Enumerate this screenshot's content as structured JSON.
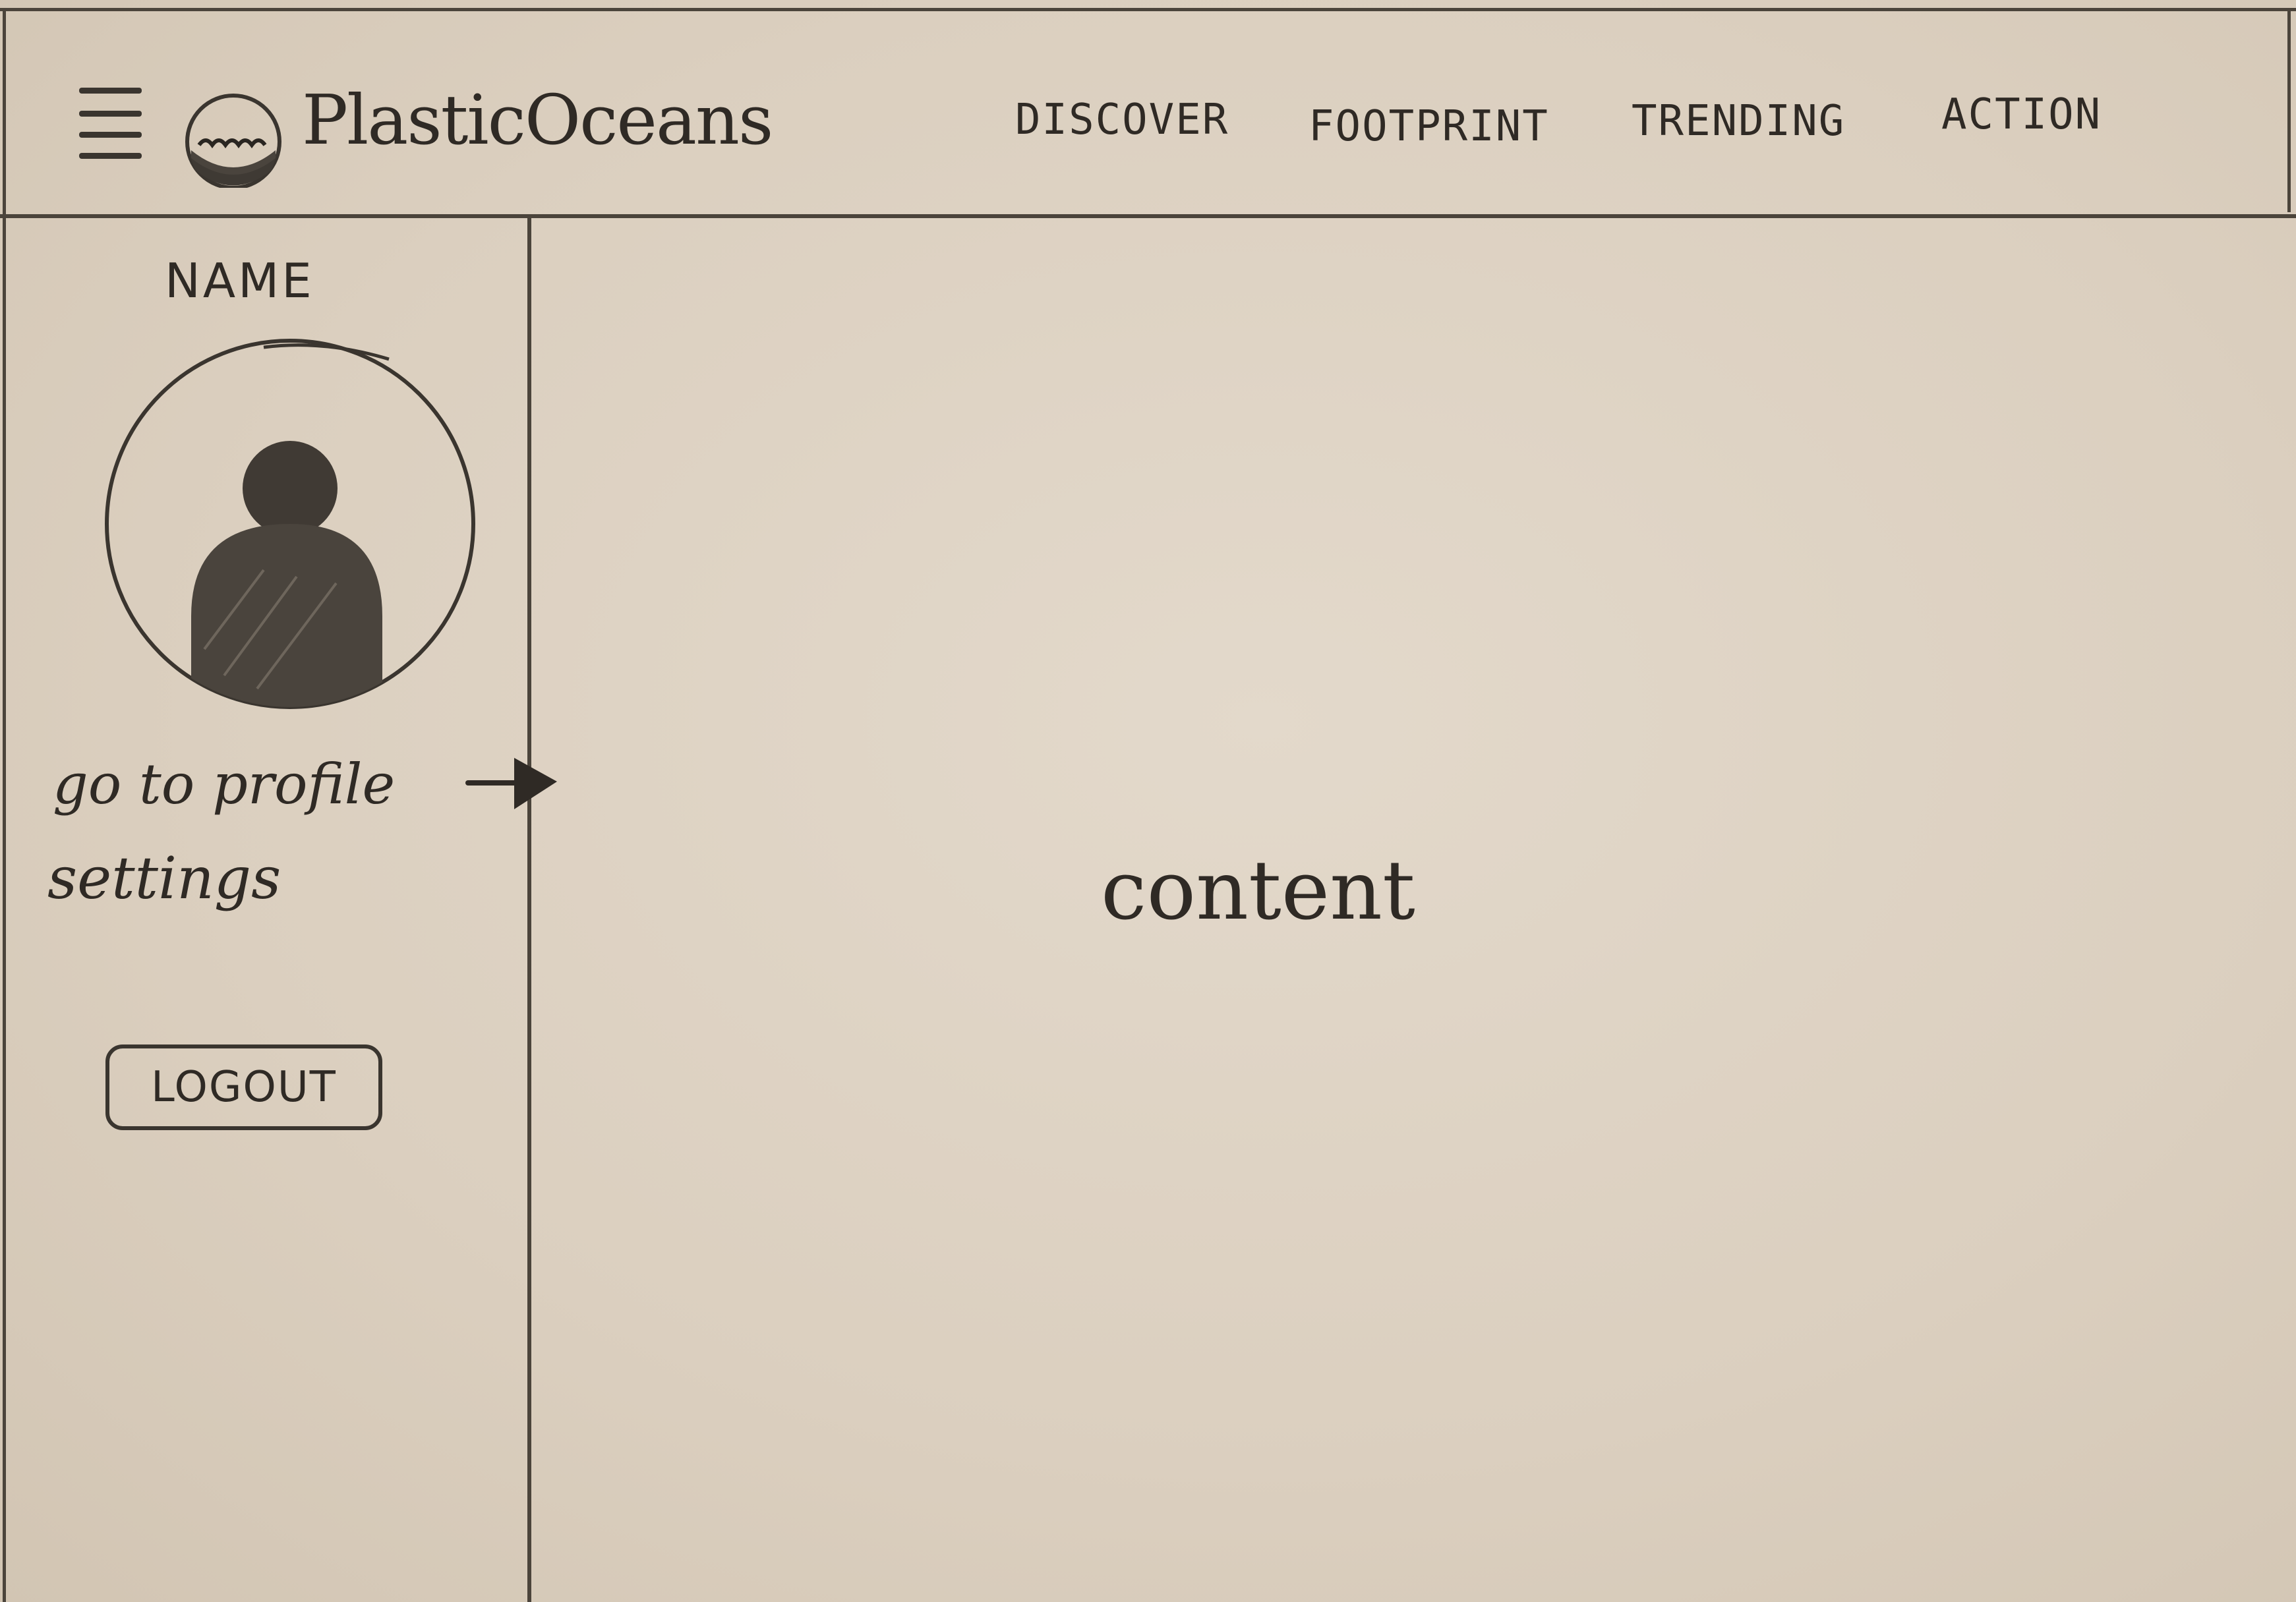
{
  "header": {
    "menu_icon": "hamburger-menu-icon",
    "logo_icon": "ocean-globe-logo-icon",
    "brand_name": "PlasticOceans",
    "nav": [
      {
        "label": "DISCOVER"
      },
      {
        "label": "FOOTPRINT"
      },
      {
        "label": "TRENDING"
      },
      {
        "label": "ACTION"
      }
    ]
  },
  "sidebar": {
    "name": "NAME",
    "avatar_icon": "user-avatar-icon",
    "profile_link": "go to profile",
    "arrow_icon": "arrow-right-icon",
    "settings_link": "settings",
    "logout_label": "LOGOUT"
  },
  "main": {
    "content_label": "content"
  },
  "colors": {
    "paper": "#ddd2c3",
    "ink": "#2f2a25"
  }
}
